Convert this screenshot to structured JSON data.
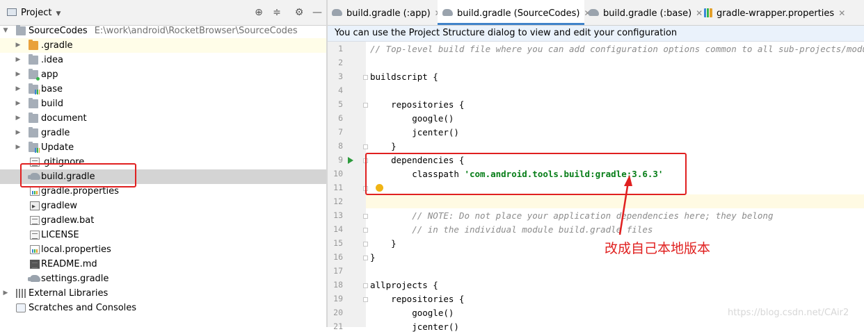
{
  "project_panel": {
    "title": "Project",
    "tree": [
      {
        "label": "SourceCodes",
        "path": "E:\\work\\android\\RocketBrowser\\SourceCodes"
      },
      {
        "label": ".gradle"
      },
      {
        "label": ".idea"
      },
      {
        "label": "app"
      },
      {
        "label": "base"
      },
      {
        "label": "build"
      },
      {
        "label": "document"
      },
      {
        "label": "gradle"
      },
      {
        "label": "Update"
      },
      {
        "label": ".gitignore"
      },
      {
        "label": "build.gradle"
      },
      {
        "label": "gradle.properties"
      },
      {
        "label": "gradlew"
      },
      {
        "label": "gradlew.bat"
      },
      {
        "label": "LICENSE"
      },
      {
        "label": "local.properties"
      },
      {
        "label": "README.md"
      },
      {
        "label": "settings.gradle"
      },
      {
        "label": "External Libraries"
      },
      {
        "label": "Scratches and Consoles"
      }
    ],
    "selected": "build.gradle"
  },
  "editor": {
    "tabs": [
      {
        "label": "build.gradle (:app)",
        "icon": "gradle-icon"
      },
      {
        "label": "build.gradle (SourceCodes)",
        "icon": "gradle-icon",
        "active": true
      },
      {
        "label": "build.gradle (:base)",
        "icon": "gradle-icon"
      },
      {
        "label": "gradle-wrapper.properties",
        "icon": "properties-icon"
      }
    ],
    "notice": "You can use the Project Structure dialog to view and edit your configuration",
    "lines": [
      {
        "n": "1",
        "text": "// Top-level build file where you can add configuration options common to all sub-projects/modules."
      },
      {
        "n": "2",
        "text": ""
      },
      {
        "n": "3",
        "text": "buildscript {"
      },
      {
        "n": "4",
        "text": ""
      },
      {
        "n": "5",
        "text": "    repositories {"
      },
      {
        "n": "6",
        "text": "        google()"
      },
      {
        "n": "7",
        "text": "        jcenter()"
      },
      {
        "n": "8",
        "text": "    }"
      },
      {
        "n": "9",
        "text": "    dependencies {"
      },
      {
        "n": "10",
        "text": "        classpath ",
        "string": "'com.android.tools.build:gradle:3.6.3'"
      },
      {
        "n": "11",
        "text": ""
      },
      {
        "n": "12",
        "text": ""
      },
      {
        "n": "13",
        "text": "        // NOTE: Do not place your application dependencies here; they belong"
      },
      {
        "n": "14",
        "text": "        // in the individual module build.gradle files"
      },
      {
        "n": "15",
        "text": "    }"
      },
      {
        "n": "16",
        "text": "}"
      },
      {
        "n": "17",
        "text": ""
      },
      {
        "n": "18",
        "text": "allprojects {"
      },
      {
        "n": "19",
        "text": "    repositories {"
      },
      {
        "n": "20",
        "text": "        google()"
      },
      {
        "n": "21",
        "text": "        jcenter()"
      }
    ]
  },
  "annotation": {
    "text": "改成自己本地版本",
    "color": "#e0201f"
  },
  "watermark": "https://blog.csdn.net/CAir2",
  "colors": {
    "accent": "#4083c9",
    "highlight_box": "#e02020",
    "string": "#067d17",
    "comment": "#8c8c8c"
  }
}
